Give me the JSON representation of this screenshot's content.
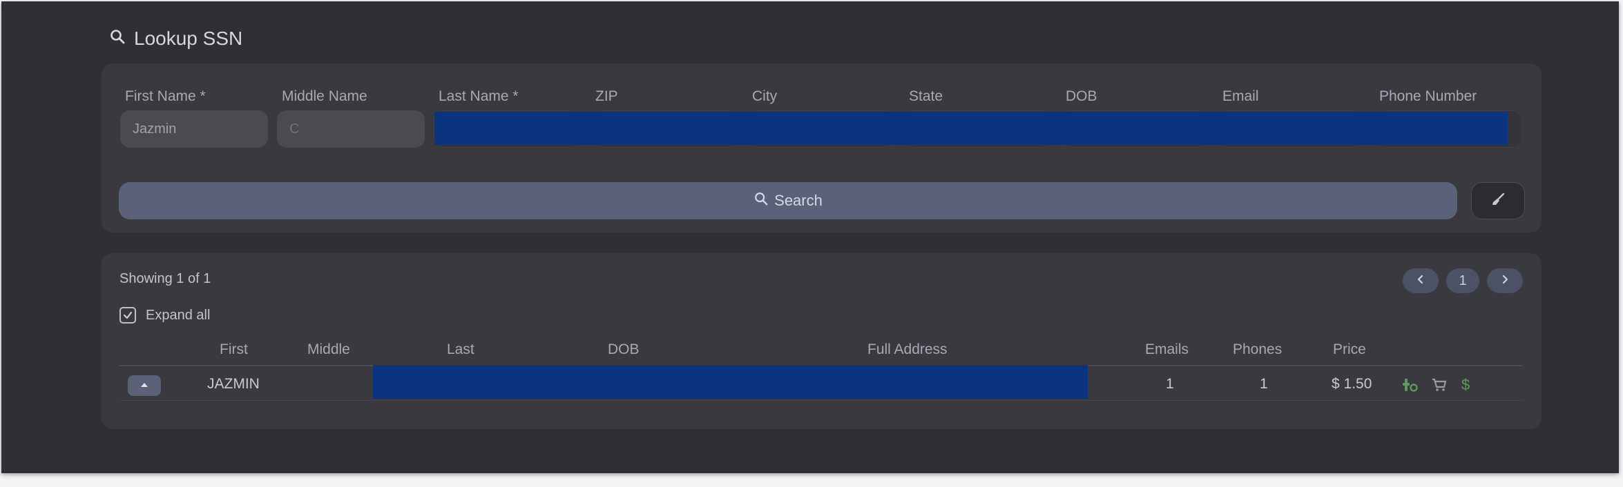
{
  "page": {
    "title": "Lookup SSN",
    "icon": "search-icon"
  },
  "search_form": {
    "fields": [
      {
        "label": "First Name *",
        "value": "Jazmin",
        "placeholder": ""
      },
      {
        "label": "Middle Name",
        "value": "",
        "placeholder": "C"
      },
      {
        "label": "Last Name *",
        "value": "",
        "placeholder": ""
      },
      {
        "label": "ZIP",
        "value": "",
        "placeholder": ""
      },
      {
        "label": "City",
        "value": "",
        "placeholder": ""
      },
      {
        "label": "State",
        "value": "",
        "placeholder": ""
      },
      {
        "label": "DOB",
        "value": "",
        "placeholder": ""
      },
      {
        "label": "Email",
        "value": "",
        "placeholder": ""
      },
      {
        "label": "Phone Number",
        "value": "",
        "placeholder": ""
      }
    ],
    "search_label": "Search",
    "clear_icon": "broom-icon"
  },
  "results": {
    "showing": "Showing 1 of 1",
    "expand_all_label": "Expand all",
    "expand_all_checked": true,
    "pagination": {
      "current_page": "1",
      "prev_icon": "chevron-left-icon",
      "next_icon": "chevron-right-icon"
    },
    "columns": [
      "First",
      "Middle",
      "Last",
      "DOB",
      "Full Address",
      "Emails",
      "Phones",
      "Price"
    ],
    "rows": [
      {
        "first": "JAZMIN",
        "middle": "",
        "emails": "1",
        "phones": "1",
        "price": "$ 1.50",
        "dollar": "$"
      }
    ]
  },
  "colors": {
    "background": "#2f2f34",
    "panel": "#39393f",
    "button": "#5b6178",
    "redaction": "#0a3380",
    "action_green": "#5f9a5c"
  }
}
